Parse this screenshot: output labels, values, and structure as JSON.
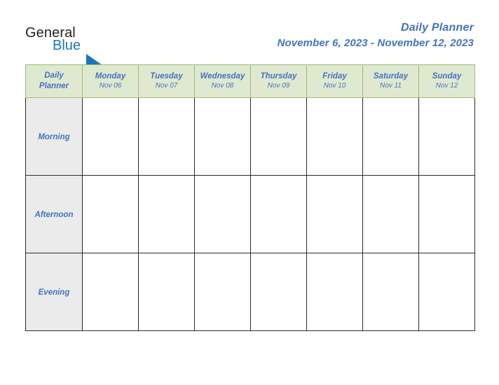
{
  "brand": {
    "word1": "General",
    "word2": "Blue",
    "triangle_color": "#1b75bb",
    "word1_color": "#231f20"
  },
  "header": {
    "title": "Daily Planner",
    "date_range": "November 6, 2023 - November 12, 2023",
    "title_color": "#4472c4"
  },
  "table": {
    "corner": {
      "line1": "Daily",
      "line2": "Planner"
    },
    "header_bg": "#dfe9cf",
    "header_border": "#9bbb7a",
    "body_border": "#2b2b2b",
    "row_label_bg": "#ebebeb",
    "columns": [
      {
        "day": "Monday",
        "date": "Nov 06"
      },
      {
        "day": "Tuesday",
        "date": "Nov 07"
      },
      {
        "day": "Wednesday",
        "date": "Nov 08"
      },
      {
        "day": "Thursday",
        "date": "Nov 09"
      },
      {
        "day": "Friday",
        "date": "Nov 10"
      },
      {
        "day": "Saturday",
        "date": "Nov 11"
      },
      {
        "day": "Sunday",
        "date": "Nov 12"
      }
    ],
    "rows": [
      {
        "label": "Morning",
        "cells": [
          "",
          "",
          "",
          "",
          "",
          "",
          ""
        ]
      },
      {
        "label": "Afternoon",
        "cells": [
          "",
          "",
          "",
          "",
          "",
          "",
          ""
        ]
      },
      {
        "label": "Evening",
        "cells": [
          "",
          "",
          "",
          "",
          "",
          "",
          ""
        ]
      }
    ]
  }
}
